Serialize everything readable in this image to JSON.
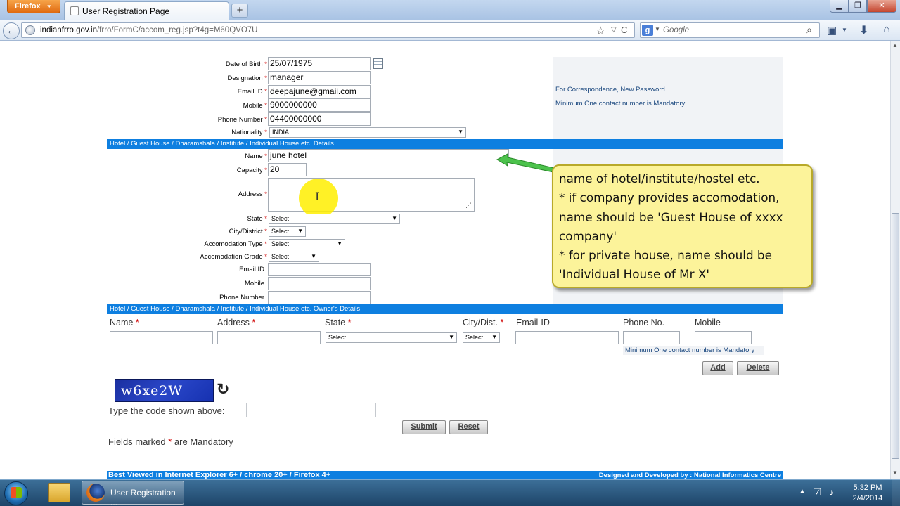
{
  "browser": {
    "app_button": "Firefox",
    "tab_title": "User Registration Page",
    "new_tab": "+",
    "window_controls": {
      "minimize": "▁",
      "maximize": "❐",
      "close": "✕"
    },
    "url_host": "indianfrro.gov.in",
    "url_path": "/frro/FormC/accom_reg.jsp?t4g=M60QVO7U",
    "search_placeholder": "Google",
    "search_engine_badge": "g",
    "icons": [
      "back-arrow-icon",
      "globe-icon",
      "star-icon",
      "reload-icon",
      "search-icon",
      "bookmark-icon",
      "download-icon",
      "home-icon"
    ]
  },
  "personal": {
    "dob_label": "Date of Birth",
    "dob_value": "25/07/1975",
    "designation_label": "Designation",
    "designation_value": "manager",
    "email_label": "Email ID",
    "email_value": "deepajune@gmail.com",
    "mobile_label": "Mobile",
    "mobile_value": "9000000000",
    "phone_label": "Phone Number",
    "phone_value": "04400000000",
    "nationality_label": "Nationality",
    "nationality_value": "INDIA"
  },
  "side_notes": {
    "email_note": "For Correspondence, New Password",
    "contact_note": "Minimum One contact number is Mandatory"
  },
  "hotel_section": {
    "title": "Hotel / Guest House / Dharamshala / Institute / Individual House etc. Details",
    "name_label": "Name",
    "name_value": "june hotel",
    "capacity_label": "Capacity",
    "capacity_value": "20",
    "address_label": "Address",
    "state_label": "State",
    "state_value": "Select",
    "city_label": "City/District",
    "city_value": "Select",
    "acc_type_label": "Accomodation Type",
    "acc_type_value": "Select",
    "acc_grade_label": "Accomodation Grade",
    "acc_grade_value": "Select",
    "email_label": "Email ID",
    "mobile_label": "Mobile",
    "phone_label": "Phone Number"
  },
  "owner_section": {
    "title": "Hotel / Guest House / Dharamshala / Institute / Individual House etc.  Owner's Details",
    "columns": [
      "Name",
      "Address",
      "State",
      "City/Dist.",
      "Email-ID",
      "Phone No.",
      "Mobile"
    ],
    "state_value": "Select",
    "city_value": "Select",
    "contact_note": "Minimum One contact number is Mandatory",
    "add_label": "Add",
    "delete_label": "Delete"
  },
  "captcha": {
    "text": "w6xe2W",
    "prompt": "Type the code shown above:",
    "submit_label": "Submit",
    "reset_label": "Reset",
    "mandatory_prefix": "Fields marked",
    "mandatory_star": "*",
    "mandatory_suffix": "are Mandatory"
  },
  "callout": {
    "lines": [
      "name of hotel/institute/hostel etc.",
      "* if company provides accomodation,",
      "name should be 'Guest House of xxxx",
      "company'",
      "* for private house, name should be",
      "'Individual House of Mr X'"
    ]
  },
  "footer": {
    "left": "Best Viewed in Internet Explorer 6+ / chrome 20+ / Firefox 4+",
    "right": "Designed and Developed by : National Informatics Centre"
  },
  "taskbar": {
    "firefox_task": "User Registration ...",
    "time": "5:32 PM",
    "date": "2/4/2014"
  },
  "colors": {
    "section_bar": "#0e7fe0",
    "required_star": "#d00000",
    "note_text": "#16447c",
    "callout_bg": "#fcf39a"
  }
}
